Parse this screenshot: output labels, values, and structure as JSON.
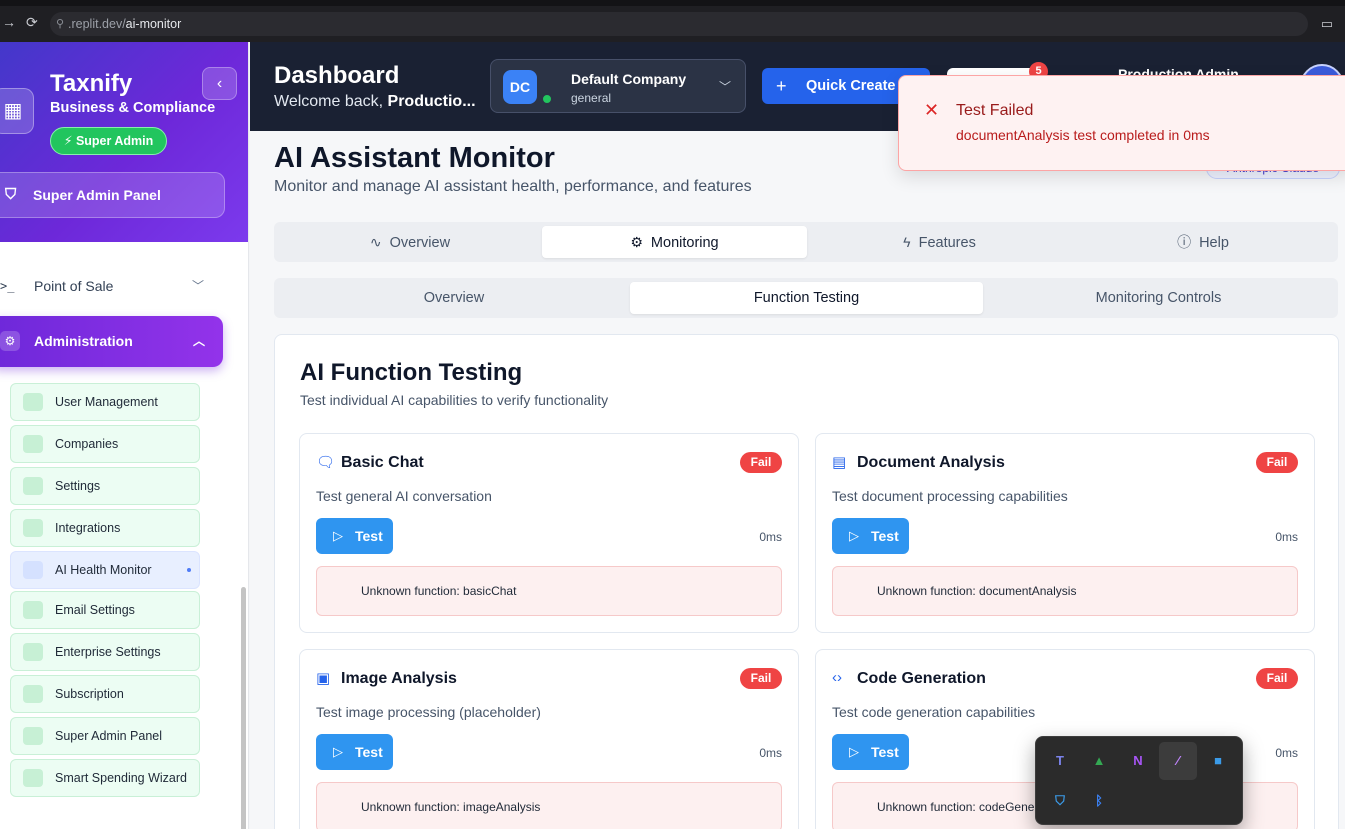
{
  "browser": {
    "url_host": ".replit.dev/",
    "url_path": "ai-monitor"
  },
  "sidebar": {
    "brand": "Taxnify",
    "brand_sub": "Business & Compliance",
    "role_badge": "⚡ Super Admin",
    "super_admin_panel": "Super Admin Panel",
    "point_of_sale": "Point of Sale",
    "administration": "Administration",
    "items": [
      {
        "label": "User Management"
      },
      {
        "label": "Companies"
      },
      {
        "label": "Settings"
      },
      {
        "label": "Integrations"
      },
      {
        "label": "AI Health Monitor"
      },
      {
        "label": "Email Settings"
      },
      {
        "label": "Enterprise Settings"
      },
      {
        "label": "Subscription"
      },
      {
        "label": "Super Admin Panel"
      },
      {
        "label": "Smart Spending Wizard"
      }
    ],
    "active_item": "AI Health Monitor"
  },
  "header": {
    "title": "Dashboard",
    "welcome_prefix": "Welcome back, ",
    "welcome_user": "Productio...",
    "company_initials": "DC",
    "company_name": "Default Company",
    "company_sub": "general",
    "quick_create": "Quick Create",
    "notification_count": "5",
    "user_name": "Production Admin"
  },
  "page": {
    "title": "AI Assistant Monitor",
    "subtitle": "Monitor and manage AI assistant health, performance, and features",
    "provider_badge": "Anthropic Claude"
  },
  "tabs_primary": [
    {
      "label": "Overview",
      "icon": "activity-icon"
    },
    {
      "label": "Monitoring",
      "icon": "gear-icon"
    },
    {
      "label": "Features",
      "icon": "zap-icon"
    },
    {
      "label": "Help",
      "icon": "info-icon"
    }
  ],
  "tabs_primary_active": "Monitoring",
  "tabs_secondary": [
    {
      "label": "Overview"
    },
    {
      "label": "Function Testing"
    },
    {
      "label": "Monitoring Controls"
    }
  ],
  "tabs_secondary_active": "Function Testing",
  "testing": {
    "title": "AI Function Testing",
    "subtitle": "Test individual AI capabilities to verify functionality",
    "test_label": "Test",
    "functions": [
      {
        "name": "Basic Chat",
        "icon": "chat-icon",
        "status": "Fail",
        "description": "Test general AI conversation",
        "time": "0ms",
        "error": "Unknown function: basicChat"
      },
      {
        "name": "Document Analysis",
        "icon": "document-icon",
        "status": "Fail",
        "description": "Test document processing capabilities",
        "time": "0ms",
        "error": "Unknown function: documentAnalysis"
      },
      {
        "name": "Image Analysis",
        "icon": "image-icon",
        "status": "Fail",
        "description": "Test image processing (placeholder)",
        "time": "0ms",
        "error": "Unknown function: imageAnalysis"
      },
      {
        "name": "Code Generation",
        "icon": "code-icon",
        "status": "Fail",
        "description": "Test code generation capabilities",
        "time": "0ms",
        "error": "Unknown function: codeGeneration"
      }
    ]
  },
  "toast": {
    "title": "Test Failed",
    "message": "documentAnalysis test completed in 0ms"
  },
  "tray": {
    "icons": [
      "teams-icon",
      "drive-icon",
      "onenote-icon",
      "feather-icon",
      "window-icon",
      "defender-icon",
      "bluetooth-icon"
    ]
  },
  "colors": {
    "sidebar_gradient_start": "#4338ca",
    "sidebar_gradient_end": "#7c3aed",
    "header_bg": "#1a2133",
    "primary_blue": "#2563eb",
    "test_button": "#2f95f0",
    "fail_red": "#ef4444",
    "success_green": "#22c55e"
  }
}
